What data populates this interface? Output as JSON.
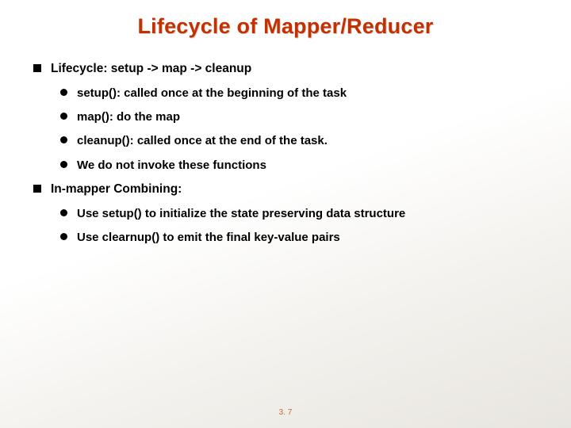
{
  "title": "Lifecycle of Mapper/Reducer",
  "bullets": [
    {
      "text": "Lifecycle: setup -> map -> cleanup",
      "sub": [
        "setup(): called once at the beginning of the task",
        "map(): do the map",
        "cleanup(): called once at the end of the task.",
        "We do not invoke these functions"
      ]
    },
    {
      "text": "In-mapper Combining:",
      "sub": [
        "Use setup() to initialize the state preserving data structure",
        "Use clearnup() to emit the final key-value pairs"
      ]
    }
  ],
  "pageNumber": "3. 7"
}
